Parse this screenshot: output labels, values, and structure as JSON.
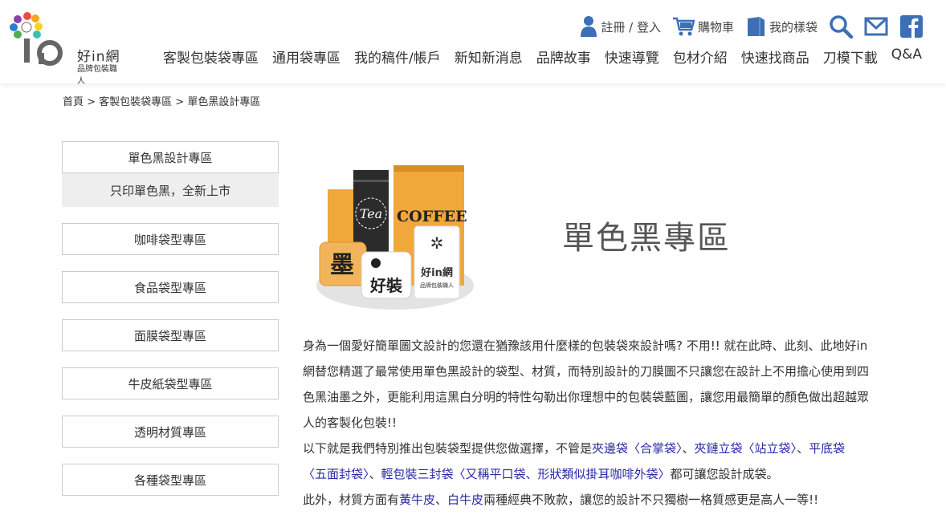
{
  "brand": {
    "name": "好in網",
    "sub": "品牌包裝職人"
  },
  "util": {
    "login": "註冊 / 登入",
    "cart": "購物車",
    "favorites": "我的樣袋"
  },
  "nav": [
    "客製包裝袋專區",
    "通用袋專區",
    "我的稿件/帳戶",
    "新知新消息",
    "品牌故事",
    "快速導覽",
    "包材介紹",
    "快速找商品",
    "刀模下載",
    "Q&A"
  ],
  "breadcrumb": "首頁 > 客製包裝袋專區 > 單色黑設計專區",
  "sidebar": {
    "items": [
      "單色黑設計專區",
      "咖啡袋型專區",
      "食品袋型專區",
      "面膜袋型專區",
      "牛皮紙袋型專區",
      "透明材質專區",
      "各種袋型專區"
    ],
    "sub": "只印單色黑，全新上市"
  },
  "hero": {
    "title": "單色黑專區",
    "bag_tea": "Tea",
    "bag_coffee": "COFFEE",
    "badge1": "墨",
    "badge2": "好裝",
    "badge3": "好in網",
    "badge3_sub": "品牌包裝職人"
  },
  "content": {
    "p1": "身為一個愛好簡單圖文設計的您還在猶豫該用什麼樣的包裝袋來設計嗎? 不用!! 就在此時、此刻、此地好in網替您精選了最常使用單色黑設計的袋型、材質，而特別設計的刀膜圖不只讓您在設計上不用擔心使用到四色黑油墨之外，更能利用這黑白分明的特性勾勒出你理想中的包裝袋藍圖，讓您用最簡單的顏色做出超越眾人的客製化包裝!!",
    "p2_a": "以下就是我們特別推出包裝袋型提供您做選擇，不管是",
    "p2_l1": "夾邊袋〈合掌袋〉",
    "p2_s1": "、",
    "p2_l2": "夾鏈立袋〈站立袋〉",
    "p2_s2": "、",
    "p2_l3": "平底袋〈五面封袋〉",
    "p2_s3": "、",
    "p2_l4": "輕包裝三封袋〈又稱平口袋、形狀類似掛耳咖啡外袋〉",
    "p2_b": "都可讓您設計成袋。",
    "p3_a": "此外，材質方面有",
    "p3_l1": "黃牛皮",
    "p3_s1": "、",
    "p3_l2": "白牛皮",
    "p3_b": "兩種經典不敗款，讓您的設計不只獨樹一格質感更是高人一等!!"
  }
}
